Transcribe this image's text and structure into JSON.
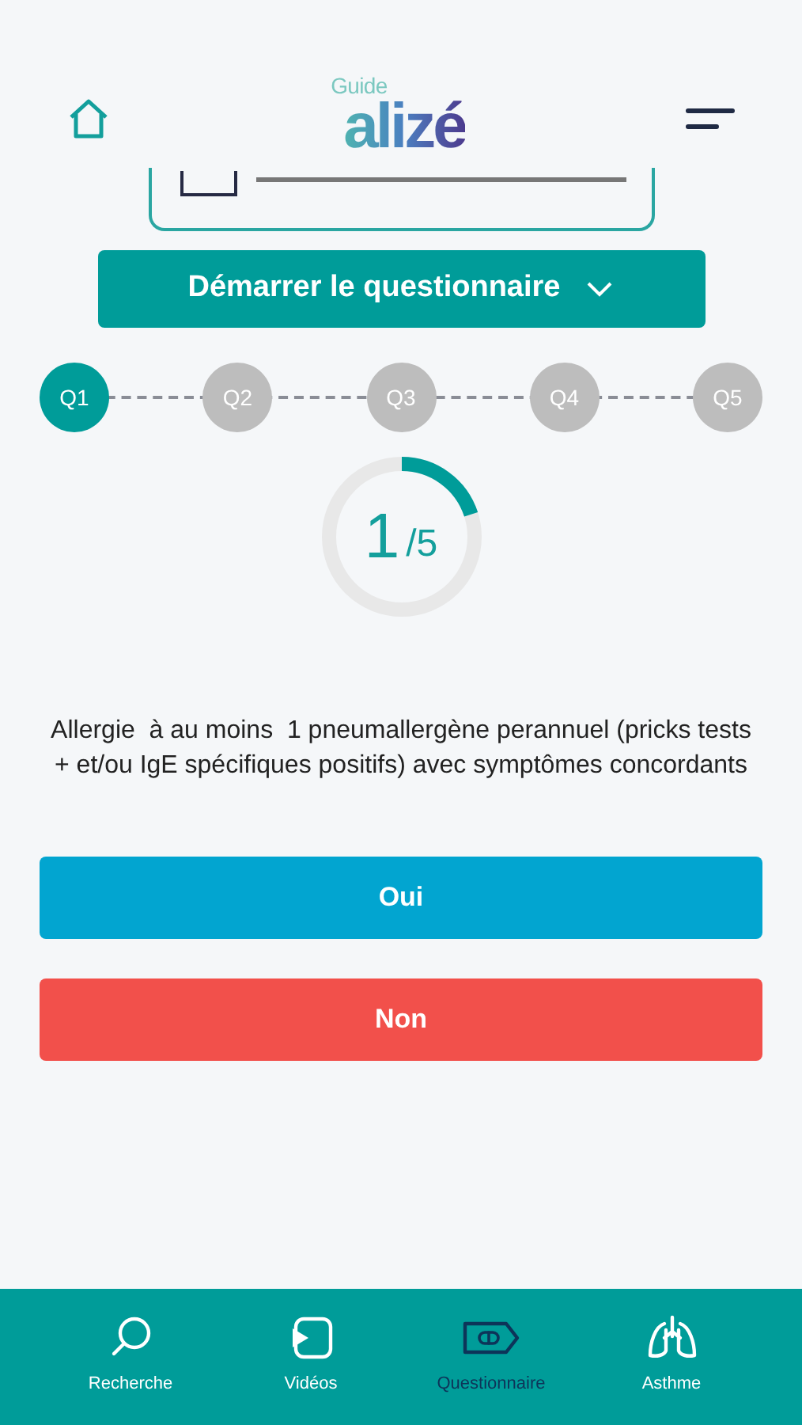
{
  "header": {
    "logo_small": "Guide",
    "logo_main": "alizé"
  },
  "start_button": {
    "label": "Démarrer le questionnaire"
  },
  "steps": [
    {
      "label": "Q1",
      "selected": true
    },
    {
      "label": "Q2",
      "selected": false
    },
    {
      "label": "Q3",
      "selected": false
    },
    {
      "label": "Q4",
      "selected": false
    },
    {
      "label": "Q5",
      "selected": false
    }
  ],
  "progress": {
    "current": "1",
    "total": "/5",
    "level": 0.2
  },
  "question": "Allergie  à au moins  1 pneumallergène perannuel (pricks tests + et/ou IgE spécifiques positifs) avec symptômes concordants",
  "answers": [
    {
      "label": "Oui",
      "kind": "yes"
    },
    {
      "label": "Non",
      "kind": "no"
    }
  ],
  "tabs": [
    {
      "label": "Recherche",
      "kind": "search",
      "selected": false
    },
    {
      "label": "Vidéos",
      "kind": "video",
      "selected": false
    },
    {
      "label": "Questionnaire",
      "kind": "pill",
      "selected": true
    },
    {
      "label": "Asthme",
      "kind": "lungs",
      "selected": false
    }
  ]
}
